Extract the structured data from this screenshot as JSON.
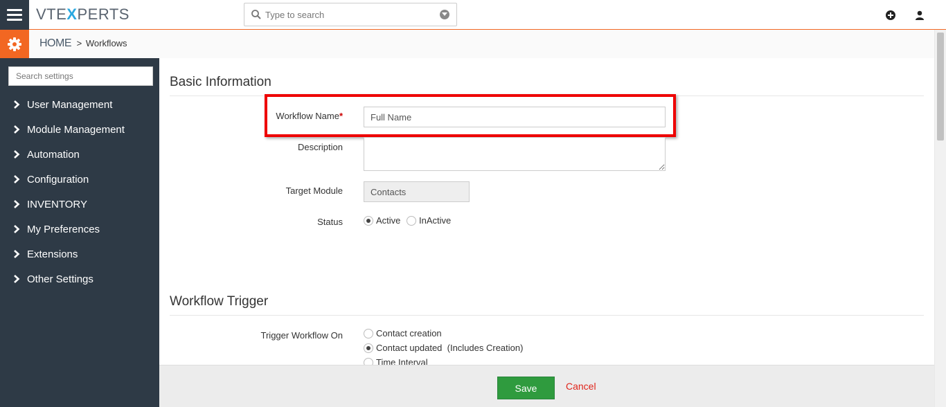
{
  "header": {
    "logo_prefix": "VTE",
    "logo_x": "X",
    "logo_suffix": "PERTS",
    "search_placeholder": "Type to search"
  },
  "breadcrumb": {
    "home": "HOME",
    "separator": ">",
    "current": "Workflows"
  },
  "sidebar": {
    "search_placeholder": "Search settings",
    "items": [
      {
        "label": "User Management"
      },
      {
        "label": "Module Management"
      },
      {
        "label": "Automation"
      },
      {
        "label": "Configuration"
      },
      {
        "label": "INVENTORY"
      },
      {
        "label": "My Preferences"
      },
      {
        "label": "Extensions"
      },
      {
        "label": "Other Settings"
      }
    ]
  },
  "basic_info": {
    "title": "Basic Information",
    "workflow_name_label": "Workflow Name",
    "required_mark": "*",
    "workflow_name_value": "Full Name",
    "description_label": "Description",
    "description_value": "",
    "target_module_label": "Target Module",
    "target_module_value": "Contacts",
    "status_label": "Status",
    "status_options": [
      "Active",
      "InActive"
    ],
    "status_selected": "Active"
  },
  "trigger": {
    "title": "Workflow Trigger",
    "label": "Trigger Workflow On",
    "options": [
      "Contact creation",
      "Contact updated  (Includes Creation)",
      "Time Interval"
    ],
    "selected": "Contact updated  (Includes Creation)"
  },
  "footer": {
    "save_label": "Save",
    "cancel_label": "Cancel"
  },
  "colors": {
    "accent": "#f26722",
    "sidebar_bg": "#2e3a46",
    "save_green": "#2f9b3e",
    "cancel_red": "#e0251b",
    "highlight_red": "#e00000"
  }
}
